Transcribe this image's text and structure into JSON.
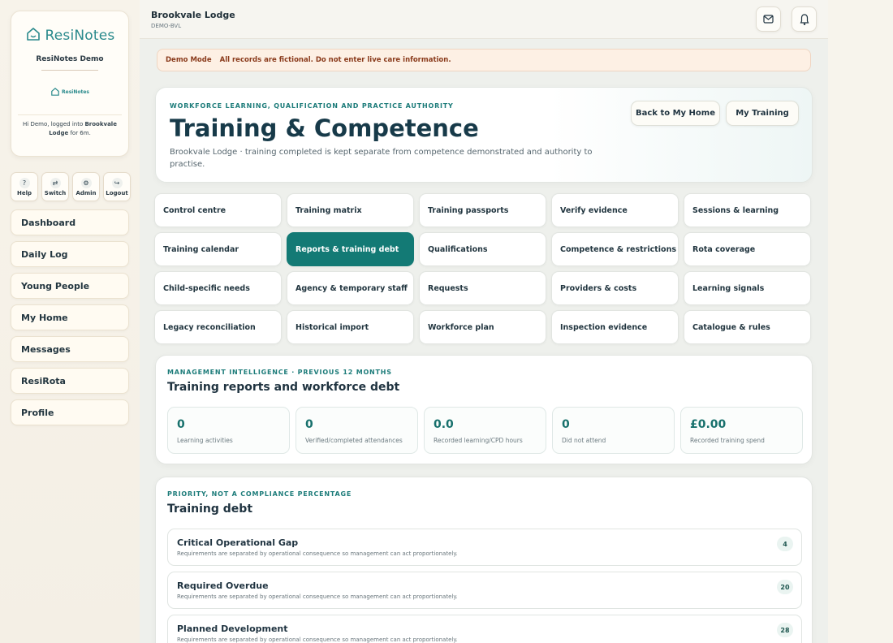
{
  "brand": {
    "name": "ResiNotes",
    "demo_name": "ResiNotes Demo",
    "mini_logo_text": "ResiNotes",
    "login_prefix": "Hi Demo, logged into ",
    "login_home": "Brookvale Lodge",
    "login_suffix": " for 6m."
  },
  "tools": [
    {
      "label": "Help",
      "icon": "?"
    },
    {
      "label": "Switch",
      "icon": "⇄"
    },
    {
      "label": "Admin",
      "icon": "⚙"
    },
    {
      "label": "Logout",
      "icon": "↪"
    }
  ],
  "nav": [
    "Dashboard",
    "Daily Log",
    "Young People",
    "My Home",
    "Messages",
    "ResiRota",
    "Profile"
  ],
  "topbar": {
    "home_name": "Brookvale Lodge",
    "home_code": "DEMO-BVL"
  },
  "banner": {
    "title": "Demo Mode",
    "text": "All records are fictional. Do not enter live care information."
  },
  "hero": {
    "kicker": "WORKFORCE LEARNING, QUALIFICATION AND PRACTICE AUTHORITY",
    "title": "Training & Competence",
    "description": "Brookvale Lodge · training completed is kept separate from competence demonstrated and authority to practise.",
    "back_button": "Back to My Home",
    "training_button": "My Training"
  },
  "tabs": [
    "Control centre",
    "Training matrix",
    "Training passports",
    "Verify evidence",
    "Sessions & learning",
    "Training calendar",
    "Reports & training debt",
    "Qualifications",
    "Competence & restrictions",
    "Rota coverage",
    "Child-specific needs",
    "Agency & temporary staff",
    "Requests",
    "Providers & costs",
    "Learning signals",
    "Legacy reconciliation",
    "Historical import",
    "Workforce plan",
    "Inspection evidence",
    "Catalogue & rules"
  ],
  "active_tab": "Reports & training debt",
  "reports": {
    "kicker": "MANAGEMENT INTELLIGENCE · PREVIOUS 12 MONTHS",
    "title": "Training reports and workforce debt",
    "stats": [
      {
        "value": "0",
        "label": "Learning activities"
      },
      {
        "value": "0",
        "label": "Verified/completed attendances"
      },
      {
        "value": "0.0",
        "label": "Recorded learning/CPD hours"
      },
      {
        "value": "0",
        "label": "Did not attend"
      },
      {
        "value": "£0.00",
        "label": "Recorded training spend"
      }
    ]
  },
  "debt": {
    "kicker": "PRIORITY, NOT A COMPLIANCE PERCENTAGE",
    "title": "Training debt",
    "items": [
      {
        "title": "Critical Operational Gap",
        "description": "Requirements are separated by operational consequence so management can act proportionately.",
        "count": "4"
      },
      {
        "title": "Required Overdue",
        "description": "Requirements are separated by operational consequence so management can act proportionately.",
        "count": "20"
      },
      {
        "title": "Planned Development",
        "description": "Requirements are separated by operational consequence so management can act proportionately.",
        "count": "28"
      }
    ]
  }
}
